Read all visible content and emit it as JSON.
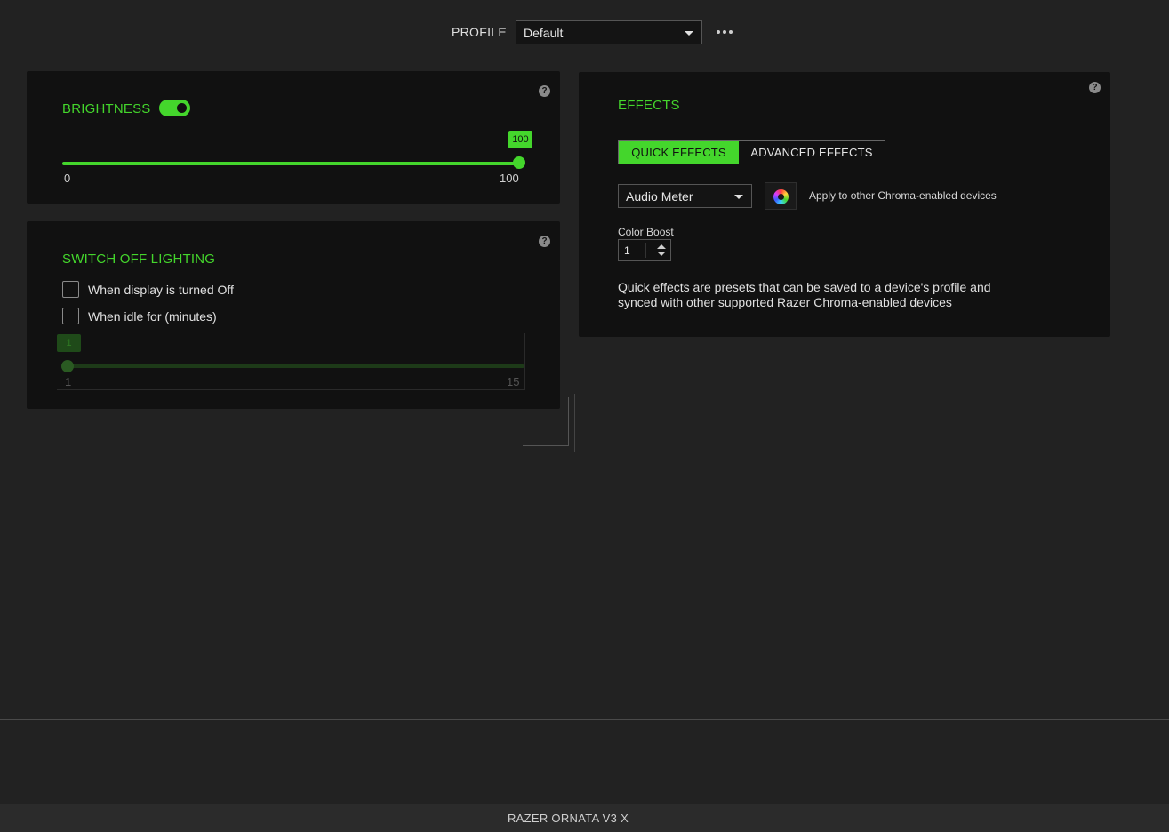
{
  "profile": {
    "label": "PROFILE",
    "selected": "Default"
  },
  "brightness": {
    "title": "BRIGHTNESS",
    "enabled": true,
    "value": "100",
    "min_label": "0",
    "max_label": "100",
    "help": "?"
  },
  "switch_off": {
    "title": "SWITCH OFF LIGHTING",
    "display_off_label": "When display is turned Off",
    "idle_label": "When idle for (minutes)",
    "idle_value": "1",
    "min_label": "1",
    "max_label": "15",
    "help": "?"
  },
  "effects": {
    "title": "EFFECTS",
    "help": "?",
    "tabs": [
      {
        "label": "QUICK EFFECTS",
        "active": true
      },
      {
        "label": "ADVANCED EFFECTS",
        "active": false
      }
    ],
    "selected_effect": "Audio Meter",
    "apply_label": "Apply to other Chroma-enabled devices",
    "color_boost_label": "Color Boost",
    "color_boost_value": "1",
    "description": "Quick effects are presets that can be saved to a device's profile and synced with other supported Razer Chroma-enabled devices"
  },
  "footer": {
    "device_name": "RAZER ORNATA V3 X"
  },
  "colors": {
    "accent": "#44d62c",
    "background": "#222222",
    "panel": "#111111"
  }
}
